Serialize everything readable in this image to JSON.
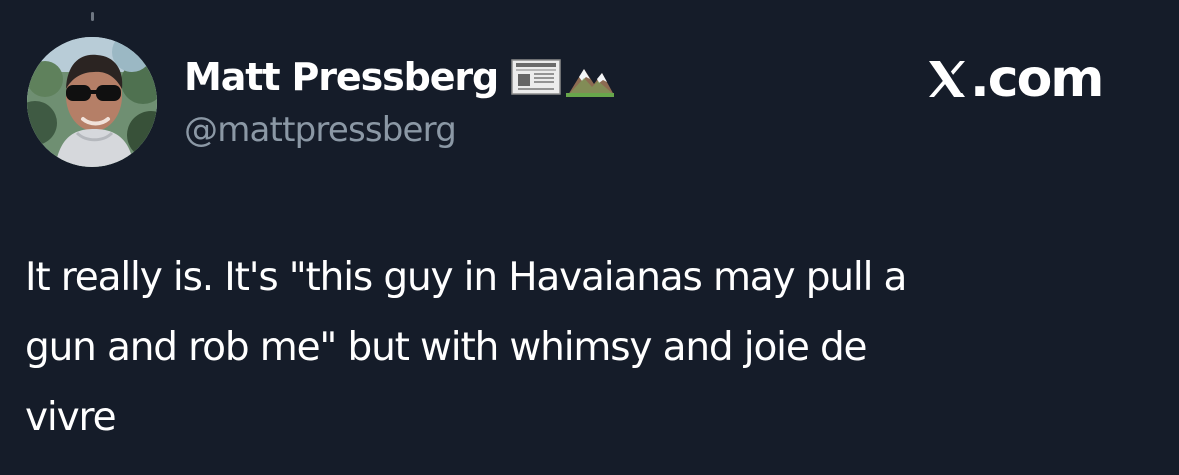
{
  "tweet": {
    "author": {
      "display_name": "Matt Pressberg",
      "handle": "@mattpressberg",
      "avatar_icon": "profile-photo",
      "name_emoji": [
        "newspaper-icon",
        "mountain-icon"
      ]
    },
    "brand": {
      "logo_icon": "x-logo-icon",
      "text": ".com"
    },
    "text": "It really is. It's \"this guy in Havaianas may pull a\ngun and rob me\" but with whimsy and joie de\nvivre"
  },
  "colors": {
    "background": "#151c29",
    "primary_text": "#ffffff",
    "secondary_text": "#8b98a5"
  }
}
